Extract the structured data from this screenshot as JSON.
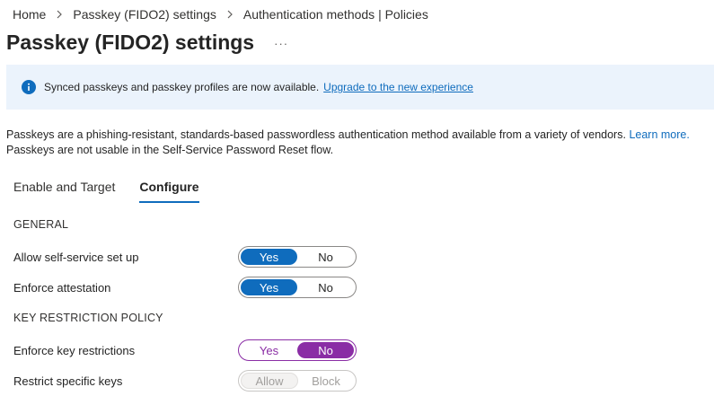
{
  "breadcrumb": {
    "items": [
      "Home",
      "Passkey (FIDO2) settings",
      "Authentication methods | Policies"
    ]
  },
  "page": {
    "title": "Passkey (FIDO2) settings",
    "more_label": "···"
  },
  "banner": {
    "text": "Synced passkeys and passkey profiles are now available.",
    "link": "Upgrade to the new experience",
    "icon": "info-icon"
  },
  "description": {
    "line1": "Passkeys are a phishing-resistant, standards-based passwordless authentication method available from a variety of vendors.",
    "learn_more": "Learn more.",
    "line2": "Passkeys are not usable in the Self-Service Password Reset flow."
  },
  "tabs": [
    {
      "label": "Enable and Target",
      "active": false
    },
    {
      "label": "Configure",
      "active": true
    }
  ],
  "general": {
    "heading": "GENERAL",
    "allow_self_service": {
      "label": "Allow self-service set up",
      "options": [
        "Yes",
        "No"
      ],
      "selected": "Yes"
    },
    "enforce_attestation": {
      "label": "Enforce attestation",
      "options": [
        "Yes",
        "No"
      ],
      "selected": "Yes"
    }
  },
  "key_restriction": {
    "heading": "KEY RESTRICTION POLICY",
    "enforce_key_restrictions": {
      "label": "Enforce key restrictions",
      "options": [
        "Yes",
        "No"
      ],
      "selected": "No"
    },
    "restrict_specific_keys": {
      "label": "Restrict specific keys",
      "options": [
        "Allow",
        "Block"
      ],
      "disabled": true
    }
  },
  "colors": {
    "accent": "#0f6cbd",
    "purple": "#8a2da5",
    "banner_bg": "#ebf3fc"
  }
}
